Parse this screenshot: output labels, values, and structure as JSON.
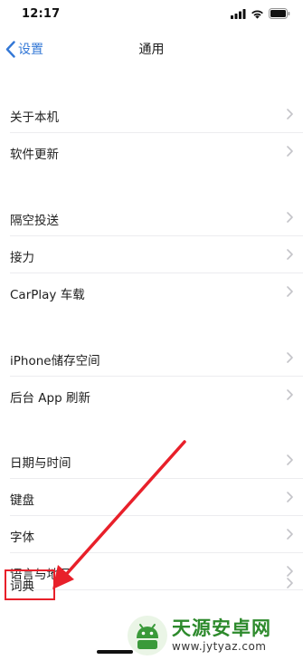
{
  "status": {
    "time": "12:17"
  },
  "nav": {
    "back_label": "设置",
    "title": "通用"
  },
  "rows": [
    {
      "label": "关于本机"
    },
    {
      "label": "软件更新"
    },
    {
      "label": "隔空投送"
    },
    {
      "label": "接力"
    },
    {
      "label": "CarPlay 车载"
    },
    {
      "label": "iPhone储存空间"
    },
    {
      "label": "后台 App 刷新"
    },
    {
      "label": "日期与时间"
    },
    {
      "label": "键盘"
    },
    {
      "label": "字体"
    },
    {
      "label": "语言与地区"
    },
    {
      "label": "词典"
    }
  ],
  "icons": {
    "back": "chevron-left-icon",
    "row_chevron": "chevron-right-icon",
    "signal": "signal-icon",
    "wifi": "wifi-icon",
    "battery": "battery-icon"
  },
  "colors": {
    "accent": "#3478d6",
    "annotation": "#e8202a",
    "watermark": "#2d8a2c"
  },
  "watermark": {
    "title": "天源安卓网",
    "url": "www.jytyaz.com"
  }
}
